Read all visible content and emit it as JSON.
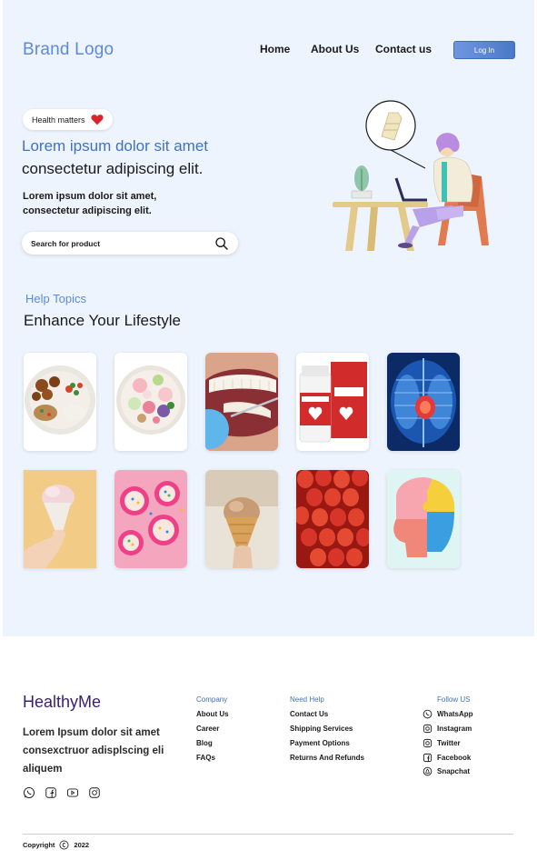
{
  "header": {
    "brand": "Brand Logo",
    "nav": [
      {
        "label": "Home"
      },
      {
        "label": "About Us"
      },
      {
        "label": "Contact us"
      }
    ],
    "login_label": "Log In"
  },
  "hero": {
    "pill_label": "Health matters",
    "title_line1": "Lorem ipsum dolor sit amet",
    "title_line2": "consectetur adipiscing elit.",
    "subtitle": "Lorem ipsum dolor sit amet, consectetur adipiscing elit.",
    "search_placeholder": "Search for product"
  },
  "topics": {
    "kicker": "Help Topics",
    "heading": "Enhance Your Lifestyle"
  },
  "footer": {
    "brand": "HealthyMe",
    "description": "Lorem Ipsum dolor sit amet consexctruor adisplscing eli aliquem",
    "company": {
      "heading": "Company",
      "items": [
        "About Us",
        "Career",
        "Blog",
        "FAQs"
      ]
    },
    "need_help": {
      "heading": "Need Help",
      "items": [
        "Contact Us",
        "Shipping Services",
        "Payment Options",
        "Returns And Refunds"
      ]
    },
    "follow": {
      "heading": "Follow US",
      "items": [
        "WhatsApp",
        "Instagram",
        "Twitter",
        "Facebook",
        "Snapchat"
      ]
    },
    "copyright": "Copyright",
    "year": "2022"
  },
  "colors": {
    "accent": "#5b8bd6",
    "hero_bg": "#eef4fd",
    "brand_dark": "#3a1f70"
  }
}
